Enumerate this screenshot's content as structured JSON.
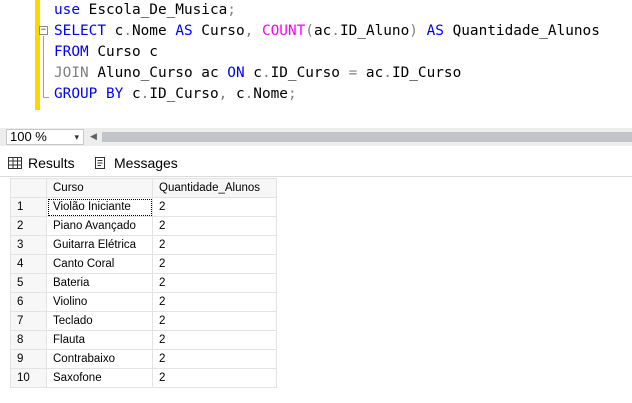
{
  "editor": {
    "lines": [
      [
        {
          "t": "use",
          "c": "kw"
        },
        {
          "t": " Escola_De_Musica",
          "c": "id"
        },
        {
          "t": ";",
          "c": "op"
        }
      ],
      [
        {
          "t": "SELECT",
          "c": "kw"
        },
        {
          "t": " c",
          "c": "id"
        },
        {
          "t": ".",
          "c": "op"
        },
        {
          "t": "Nome ",
          "c": "id"
        },
        {
          "t": "AS",
          "c": "kw"
        },
        {
          "t": " Curso",
          "c": "id"
        },
        {
          "t": ", ",
          "c": "op"
        },
        {
          "t": "COUNT",
          "c": "fn"
        },
        {
          "t": "(",
          "c": "op"
        },
        {
          "t": "ac",
          "c": "id"
        },
        {
          "t": ".",
          "c": "op"
        },
        {
          "t": "ID_Aluno",
          "c": "id"
        },
        {
          "t": ")",
          "c": "op"
        },
        {
          "t": " AS",
          "c": "kw"
        },
        {
          "t": " Quantidade_Alunos",
          "c": "id"
        }
      ],
      [
        {
          "t": "FROM",
          "c": "kw"
        },
        {
          "t": " Curso c",
          "c": "id"
        }
      ],
      [
        {
          "t": "JOIN",
          "c": "op"
        },
        {
          "t": " Aluno_Curso ac ",
          "c": "id"
        },
        {
          "t": "ON",
          "c": "kw"
        },
        {
          "t": " c",
          "c": "id"
        },
        {
          "t": ".",
          "c": "op"
        },
        {
          "t": "ID_Curso ",
          "c": "id"
        },
        {
          "t": "=",
          "c": "op"
        },
        {
          "t": " ac",
          "c": "id"
        },
        {
          "t": ".",
          "c": "op"
        },
        {
          "t": "ID_Curso",
          "c": "id"
        }
      ],
      [
        {
          "t": "GROUP BY",
          "c": "kw"
        },
        {
          "t": " c",
          "c": "id"
        },
        {
          "t": ".",
          "c": "op"
        },
        {
          "t": "ID_Curso",
          "c": "id"
        },
        {
          "t": ", ",
          "c": "op"
        },
        {
          "t": "c",
          "c": "id"
        },
        {
          "t": ".",
          "c": "op"
        },
        {
          "t": "Nome",
          "c": "id"
        },
        {
          "t": ";",
          "c": "op"
        }
      ]
    ],
    "collapse_symbol": "−"
  },
  "zoom": {
    "value": "100 %",
    "caret": "▾",
    "scroll_left": "◀"
  },
  "tabs": {
    "results": "Results",
    "messages": "Messages"
  },
  "grid": {
    "headers": [
      "Curso",
      "Quantidade_Alunos"
    ],
    "rows": [
      [
        "1",
        "Violão Iniciante",
        "2"
      ],
      [
        "2",
        "Piano Avançado",
        "2"
      ],
      [
        "3",
        "Guitarra Elétrica",
        "2"
      ],
      [
        "4",
        "Canto Coral",
        "2"
      ],
      [
        "5",
        "Bateria",
        "2"
      ],
      [
        "6",
        "Violino",
        "2"
      ],
      [
        "7",
        "Teclado",
        "2"
      ],
      [
        "8",
        "Flauta",
        "2"
      ],
      [
        "9",
        "Contrabaixo",
        "2"
      ],
      [
        "10",
        "Saxofone",
        "2"
      ]
    ],
    "selected_row_index": 0
  },
  "colors": {
    "keyword": "#0000ff",
    "function": "#ff00ff",
    "operator": "#808080",
    "change_bar": "#ffd600"
  }
}
